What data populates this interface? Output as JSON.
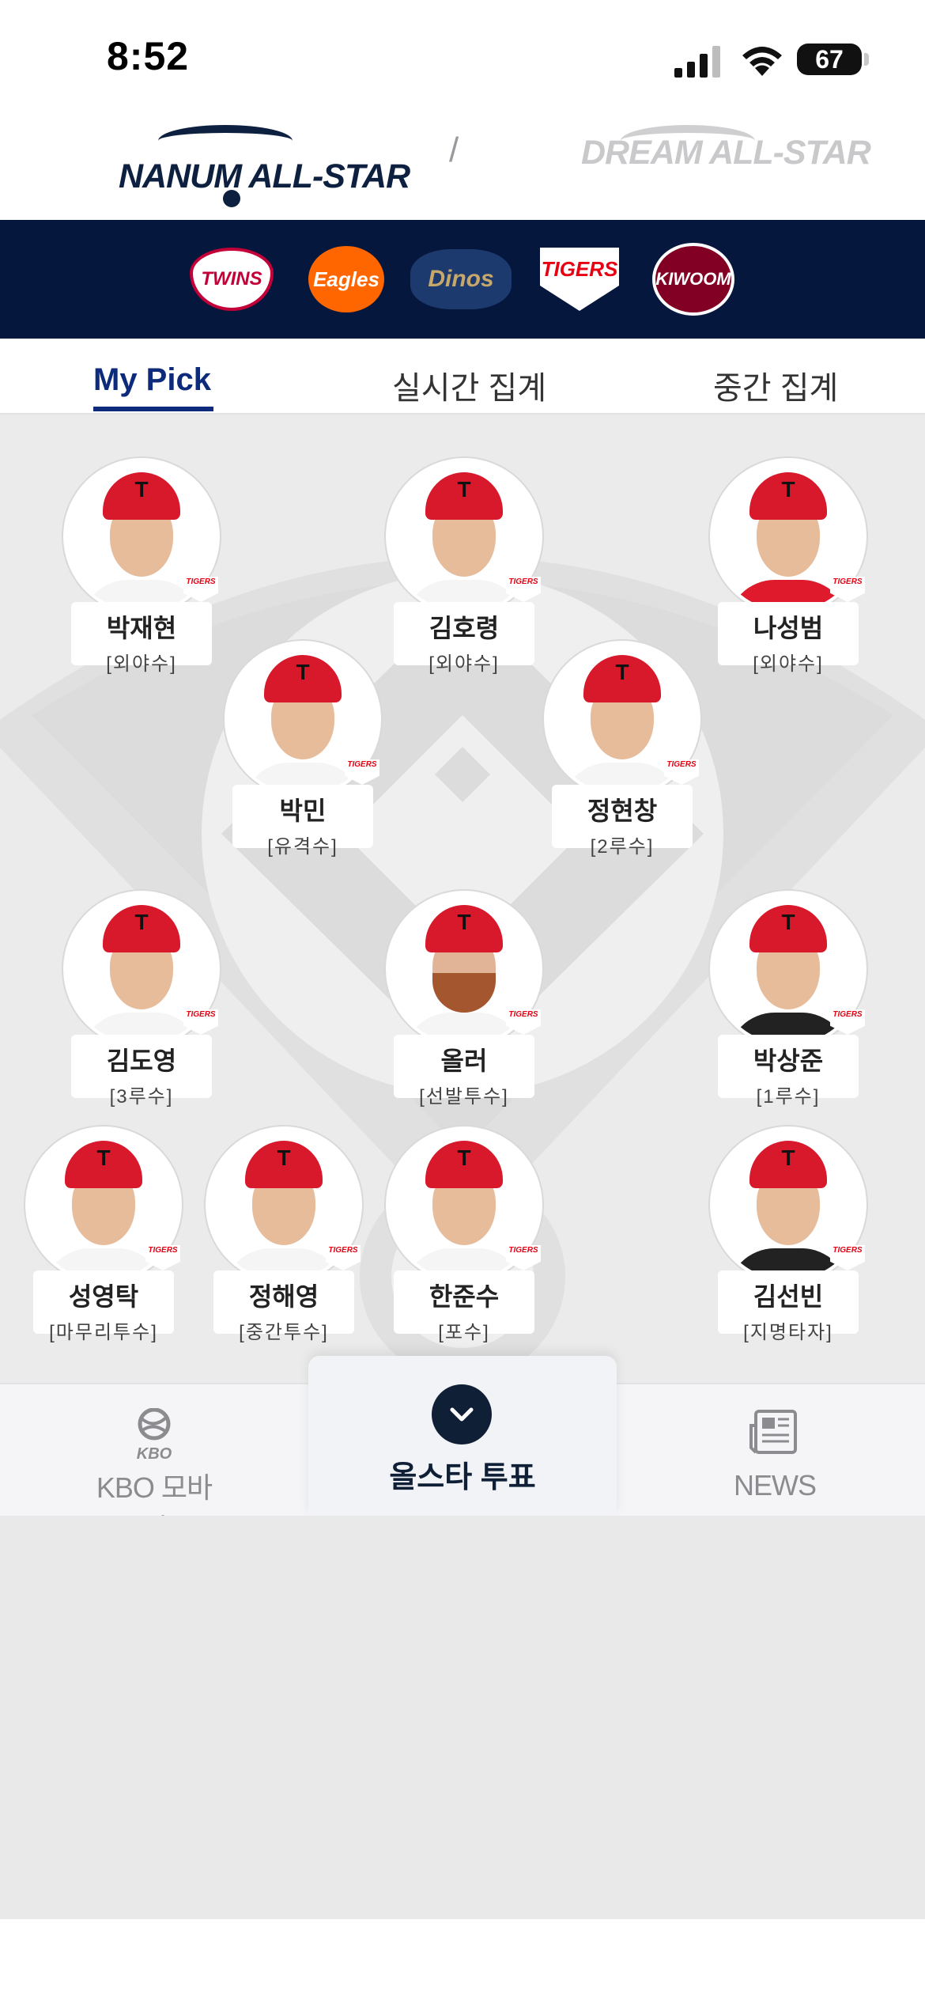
{
  "status_bar": {
    "time": "8:52",
    "battery": "67"
  },
  "header": {
    "left_logo": "NANUM ALL-STAR",
    "separator": "/",
    "right_logo": "DREAM ALL-STAR"
  },
  "teams": [
    {
      "name": "TWINS",
      "icon": "lg-twins-logo"
    },
    {
      "name": "Eagles",
      "icon": "hanwha-eagles-logo"
    },
    {
      "name": "Dinos",
      "icon": "nc-dinos-logo"
    },
    {
      "name": "TIGERS",
      "icon": "kia-tigers-logo"
    },
    {
      "name": "KIWOOM",
      "icon": "kiwoom-heroes-logo"
    }
  ],
  "tabs": [
    "My Pick",
    "실시간 집계",
    "중간 집계"
  ],
  "players": [
    {
      "name": "박재현",
      "position": "[외야수]",
      "team": "TIGERS"
    },
    {
      "name": "김호령",
      "position": "[외야수]",
      "team": "TIGERS"
    },
    {
      "name": "나성범",
      "position": "[외야수]",
      "team": "TIGERS"
    },
    {
      "name": "박민",
      "position": "[유격수]",
      "team": "TIGERS"
    },
    {
      "name": "정현창",
      "position": "[2루수]",
      "team": "TIGERS"
    },
    {
      "name": "김도영",
      "position": "[3루수]",
      "team": "TIGERS"
    },
    {
      "name": "올러",
      "position": "[선발투수]",
      "team": "TIGERS"
    },
    {
      "name": "박상준",
      "position": "[1루수]",
      "team": "TIGERS"
    },
    {
      "name": "성영탁",
      "position": "[마무리투수]",
      "team": "TIGERS"
    },
    {
      "name": "정해영",
      "position": "[중간투수]",
      "team": "TIGERS"
    },
    {
      "name": "한준수",
      "position": "[포수]",
      "team": "TIGERS"
    },
    {
      "name": "김선빈",
      "position": "[지명타자]",
      "team": "TIGERS"
    }
  ],
  "bottom_nav": {
    "kbo_sub": "KBO",
    "kbo_label": "KBO 모바일",
    "vote_label": "올스타 투표",
    "news_label": "NEWS"
  },
  "colors": {
    "navy": "#06173d",
    "accent": "#0d2b7a",
    "tigers_red": "#e60012"
  }
}
